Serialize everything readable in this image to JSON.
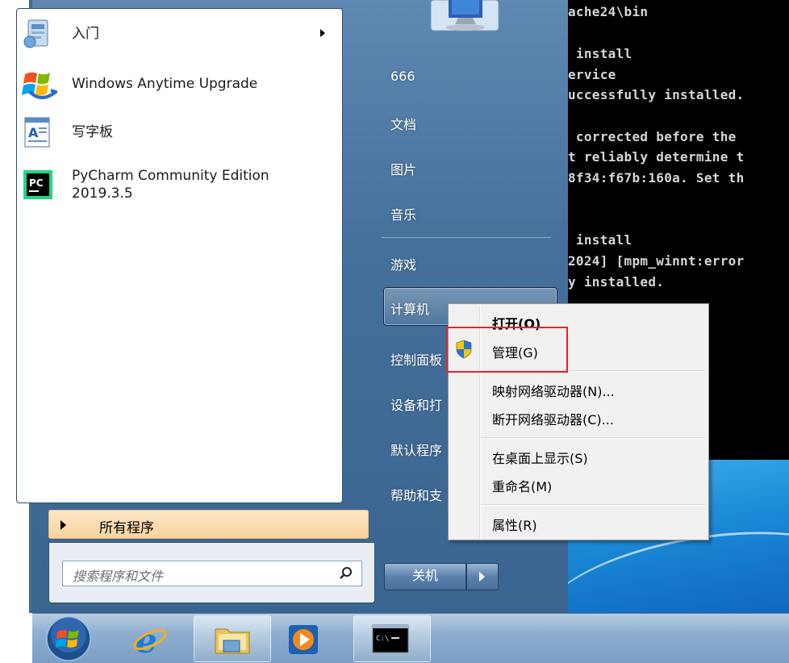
{
  "console": {
    "lines": [
      "ache24\\bin",
      " install",
      "ervice",
      "uccessfully installed.",
      " corrected before the",
      "t reliably determine t",
      "8f34:f67b:160a. Set th",
      " install",
      "2024] [mpm_winnt:error",
      "y installed."
    ]
  },
  "start_menu": {
    "left_items": [
      {
        "label": "入门",
        "icon": "getting-started-icon",
        "has_arrow": true
      },
      {
        "label": "Windows Anytime Upgrade",
        "icon": "windows-flag-icon"
      },
      {
        "label": "写字板",
        "icon": "wordpad-icon"
      },
      {
        "label": "PyCharm Community Edition",
        "label2": "2019.3.5",
        "icon": "pycharm-icon"
      }
    ],
    "all_programs": "所有程序",
    "search_placeholder": "搜索程序和文件",
    "right_items": [
      "666",
      "文档",
      "图片",
      "音乐",
      "游戏",
      "计算机",
      "控制面板",
      "设备和打",
      "默认程序",
      "帮助和支"
    ],
    "shutdown_label": "关机"
  },
  "context_menu": {
    "items": [
      "打开(O)",
      "管理(G)",
      "映射网络驱动器(N)...",
      "断开网络驱动器(C)...",
      "在桌面上显示(S)",
      "重命名(M)",
      "属性(R)"
    ]
  },
  "taskbar": {
    "icons": [
      "start-orb-icon",
      "internet-explorer-icon",
      "windows-explorer-icon",
      "media-player-icon",
      "command-prompt-icon"
    ]
  },
  "colors": {
    "highlight_box": "#e0262b",
    "all_programs_bg": "#f9d39e"
  }
}
